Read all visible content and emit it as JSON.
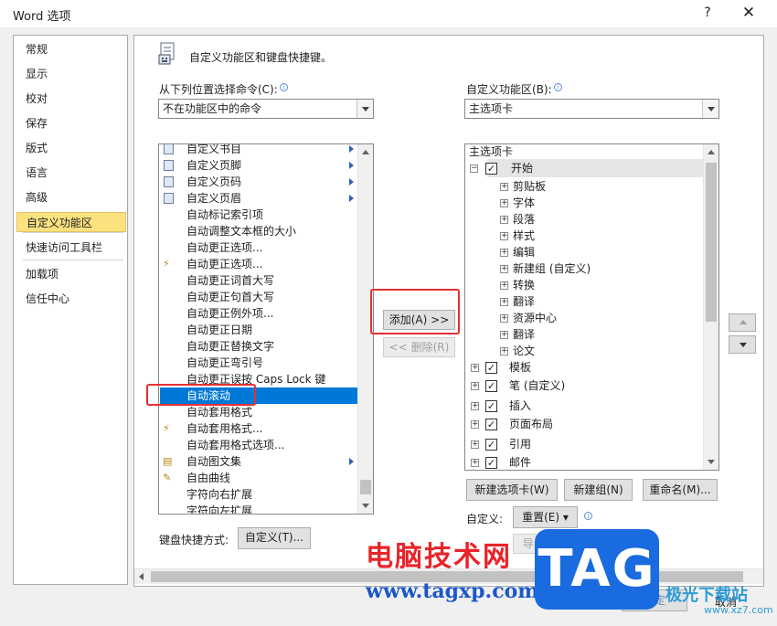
{
  "window": {
    "title": "Word 选项",
    "help": "?",
    "close": "✕"
  },
  "nav": {
    "items": [
      "常规",
      "显示",
      "校对",
      "保存",
      "版式",
      "语言",
      "高级",
      "自定义功能区",
      "快速访问工具栏",
      "加载项",
      "信任中心"
    ],
    "selected": "自定义功能区"
  },
  "header": {
    "title": "自定义功能区和键盘快捷键。"
  },
  "left_panel": {
    "label": "从下列位置选择命令(C):",
    "dropdown_value": "不在功能区中的命令",
    "commands": [
      {
        "label": "自定义书目",
        "icon": "doc-icon",
        "submenu": true
      },
      {
        "label": "自定义页脚",
        "icon": "doc-icon",
        "submenu": true
      },
      {
        "label": "自定义页码",
        "icon": "doc-icon",
        "submenu": true
      },
      {
        "label": "自定义页眉",
        "icon": "doc-icon",
        "submenu": true
      },
      {
        "label": "自动标记索引项",
        "icon": "",
        "submenu": false
      },
      {
        "label": "自动调整文本框的大小",
        "icon": "",
        "submenu": false
      },
      {
        "label": "自动更正选项...",
        "icon": "",
        "submenu": false
      },
      {
        "label": "自动更正选项...",
        "icon": "lightning-icon",
        "submenu": false
      },
      {
        "label": "自动更正词首大写",
        "icon": "",
        "submenu": false
      },
      {
        "label": "自动更正句首大写",
        "icon": "",
        "submenu": false
      },
      {
        "label": "自动更正例外项...",
        "icon": "",
        "submenu": false
      },
      {
        "label": "自动更正日期",
        "icon": "",
        "submenu": false
      },
      {
        "label": "自动更正替换文字",
        "icon": "",
        "submenu": false
      },
      {
        "label": "自动更正弯引号",
        "icon": "",
        "submenu": false
      },
      {
        "label": "自动更正误按 Caps Lock 键",
        "icon": "",
        "submenu": false
      },
      {
        "label": "自动滚动",
        "icon": "",
        "submenu": false
      },
      {
        "label": "自动套用格式",
        "icon": "",
        "submenu": false
      },
      {
        "label": "自动套用格式...",
        "icon": "lightning-icon",
        "submenu": false
      },
      {
        "label": "自动套用格式选项...",
        "icon": "",
        "submenu": false
      },
      {
        "label": "自动图文集",
        "icon": "autotext-icon",
        "submenu": true
      },
      {
        "label": "自由曲线",
        "icon": "freeform-icon",
        "submenu": false
      },
      {
        "label": "字符向右扩展",
        "icon": "",
        "submenu": false
      },
      {
        "label": "字符向左扩展",
        "icon": "",
        "submenu": false
      }
    ],
    "selected_command": "自动滚动",
    "shortcut_label": "键盘快捷方式:",
    "shortcut_button": "自定义(T)..."
  },
  "middle": {
    "add_button": "添加(A) >>",
    "remove_button": "<< 删除(R)"
  },
  "right_panel": {
    "label": "自定义功能区(B):",
    "dropdown_value": "主选项卡",
    "tree_header": "主选项卡",
    "tree": [
      {
        "label": "开始",
        "level": 0,
        "expand": "⊟",
        "checked": true,
        "highlight": true
      },
      {
        "label": "剪贴板",
        "level": 1,
        "expand": "+"
      },
      {
        "label": "字体",
        "level": 1,
        "expand": "+"
      },
      {
        "label": "段落",
        "level": 1,
        "expand": "+"
      },
      {
        "label": "样式",
        "level": 1,
        "expand": "+"
      },
      {
        "label": "编辑",
        "level": 1,
        "expand": "+"
      },
      {
        "label": "新建组 (自定义)",
        "level": 1,
        "expand": "+"
      },
      {
        "label": "转换",
        "level": 1,
        "expand": "+"
      },
      {
        "label": "翻译",
        "level": 1,
        "expand": "+"
      },
      {
        "label": "资源中心",
        "level": 1,
        "expand": "+"
      },
      {
        "label": "翻译",
        "level": 1,
        "expand": "+"
      },
      {
        "label": "论文",
        "level": 1,
        "expand": "+"
      },
      {
        "label": "模板",
        "level": 0,
        "expand": "+",
        "checked": true
      },
      {
        "label": "笔 (自定义)",
        "level": 0,
        "expand": "+",
        "checked": true
      },
      {
        "label": "插入",
        "level": 0,
        "expand": "+",
        "checked": true
      },
      {
        "label": "页面布局",
        "level": 0,
        "expand": "+",
        "checked": true
      },
      {
        "label": "引用",
        "level": 0,
        "expand": "+",
        "checked": true
      },
      {
        "label": "邮件",
        "level": 0,
        "expand": "+",
        "checked": true
      }
    ],
    "new_tab_button": "新建选项卡(W)",
    "new_group_button": "新建组(N)",
    "rename_button": "重命名(M)...",
    "customize_label": "自定义:",
    "reset_button": "重置(E) ▾",
    "import_export_button": "导入/导出(P) ▾"
  },
  "footer": {
    "ok_button": "确定",
    "cancel_button": "取消"
  },
  "watermark": {
    "text": "电脑技术网",
    "url": "www.tagxp.com",
    "tag": "TAG",
    "logo": "极光下载站",
    "site": "www.xz7.com"
  },
  "colors": {
    "selection": "#0078d7",
    "nav_selected": "#fce17f",
    "highlight_box": "#e53030"
  }
}
